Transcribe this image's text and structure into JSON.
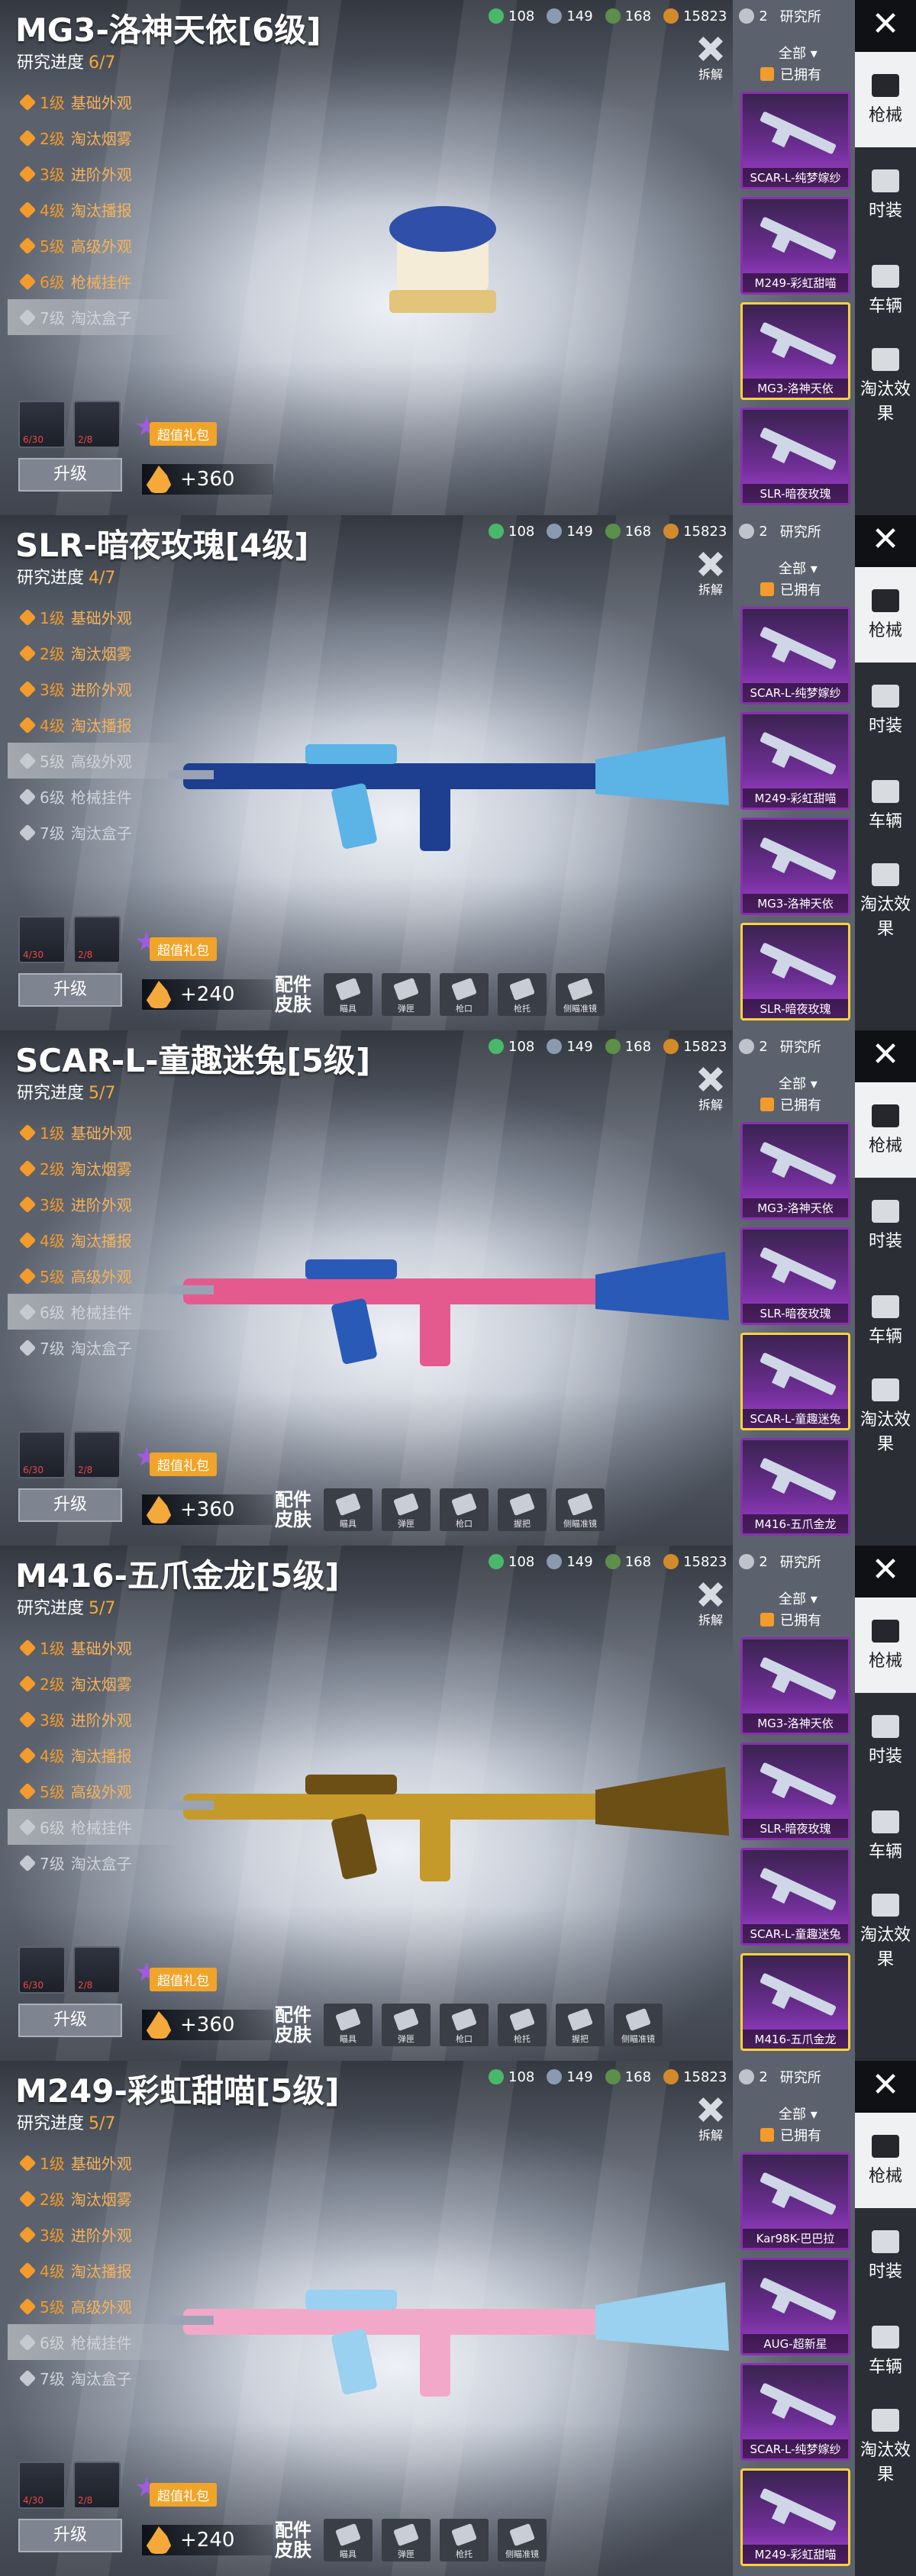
{
  "top_stats": [
    {
      "icon": "gem-icon",
      "value": "108",
      "color": "#4ab86a"
    },
    {
      "icon": "info-icon",
      "value": "149",
      "color": "#8a9ab0"
    },
    {
      "icon": "planet-icon",
      "value": "168",
      "color": "#5c8f4a"
    },
    {
      "icon": "coin-icon",
      "value": "15823",
      "color": "#d38a2a"
    },
    {
      "icon": "research-icon",
      "value": "2",
      "color": "#bfc4cc"
    }
  ],
  "research_label": "研究所",
  "toggle_label": "拆解",
  "filter": {
    "selected": "全部",
    "owned": "已拥有"
  },
  "nav": [
    "枪械",
    "时装",
    "车辆",
    "淘汰效果"
  ],
  "upgrade": "升级",
  "gift": "超值礼包",
  "parts_label": "配件皮肤",
  "progress_label": "研究进度",
  "panels": [
    {
      "title": "MG3-洛神天依[6级]",
      "progress": "6/7",
      "levels": [
        [
          "1级",
          "基础外观"
        ],
        [
          "2级",
          "淘汰烟雾"
        ],
        [
          "3级",
          "进阶外观"
        ],
        [
          "4级",
          "淘汰播报"
        ],
        [
          "5级",
          "高级外观"
        ],
        [
          "6级",
          "枪械挂件"
        ],
        [
          "7级",
          "淘汰盒子"
        ]
      ],
      "unlocked": 6,
      "points": "+360",
      "skins": [
        "SCAR-L-纯梦嫁纱",
        "M249-彩虹甜喵",
        "MG3-洛神天依",
        "SLR-暗夜玫瑰"
      ],
      "sel": 2,
      "parts": [],
      "counts": [
        "6/30",
        "2/8"
      ]
    },
    {
      "title": "SLR-暗夜玫瑰[4级]",
      "progress": "4/7",
      "levels": [
        [
          "1级",
          "基础外观"
        ],
        [
          "2级",
          "淘汰烟雾"
        ],
        [
          "3级",
          "进阶外观"
        ],
        [
          "4级",
          "淘汰播报"
        ],
        [
          "5级",
          "高级外观"
        ],
        [
          "6级",
          "枪械挂件"
        ],
        [
          "7级",
          "淘汰盒子"
        ]
      ],
      "unlocked": 4,
      "points": "+240",
      "skins": [
        "SCAR-L-纯梦嫁纱",
        "M249-彩虹甜喵",
        "MG3-洛神天依",
        "SLR-暗夜玫瑰"
      ],
      "sel": 3,
      "parts": [
        "瞄具",
        "弹匣",
        "枪口",
        "枪托",
        "侧瞄准镜"
      ],
      "counts": [
        "4/30",
        "2/8"
      ]
    },
    {
      "title": "SCAR-L-童趣迷兔[5级]",
      "progress": "5/7",
      "levels": [
        [
          "1级",
          "基础外观"
        ],
        [
          "2级",
          "淘汰烟雾"
        ],
        [
          "3级",
          "进阶外观"
        ],
        [
          "4级",
          "淘汰播报"
        ],
        [
          "5级",
          "高级外观"
        ],
        [
          "6级",
          "枪械挂件"
        ],
        [
          "7级",
          "淘汰盒子"
        ]
      ],
      "unlocked": 5,
      "points": "+360",
      "skins": [
        "MG3-洛神天依",
        "SLR-暗夜玫瑰",
        "SCAR-L-童趣迷兔",
        "M416-五爪金龙"
      ],
      "sel": 2,
      "parts": [
        "瞄具",
        "弹匣",
        "枪口",
        "握把",
        "侧瞄准镜"
      ],
      "counts": [
        "6/30",
        "2/8"
      ]
    },
    {
      "title": "M416-五爪金龙[5级]",
      "progress": "5/7",
      "levels": [
        [
          "1级",
          "基础外观"
        ],
        [
          "2级",
          "淘汰烟雾"
        ],
        [
          "3级",
          "进阶外观"
        ],
        [
          "4级",
          "淘汰播报"
        ],
        [
          "5级",
          "高级外观"
        ],
        [
          "6级",
          "枪械挂件"
        ],
        [
          "7级",
          "淘汰盒子"
        ]
      ],
      "unlocked": 5,
      "points": "+360",
      "skins": [
        "MG3-洛神天依",
        "SLR-暗夜玫瑰",
        "SCAR-L-童趣迷兔",
        "M416-五爪金龙"
      ],
      "sel": 3,
      "parts": [
        "瞄具",
        "弹匣",
        "枪口",
        "枪托",
        "握把",
        "侧瞄准镜"
      ],
      "counts": [
        "6/30",
        "2/8"
      ]
    },
    {
      "title": "M249-彩虹甜喵[5级]",
      "progress": "5/7",
      "levels": [
        [
          "1级",
          "基础外观"
        ],
        [
          "2级",
          "淘汰烟雾"
        ],
        [
          "3级",
          "进阶外观"
        ],
        [
          "4级",
          "淘汰播报"
        ],
        [
          "5级",
          "高级外观"
        ],
        [
          "6级",
          "枪械挂件"
        ],
        [
          "7级",
          "淘汰盒子"
        ]
      ],
      "unlocked": 5,
      "points": "+240",
      "skins": [
        "Kar98K-巴巴拉",
        "AUG-超新星",
        "SCAR-L-纯梦嫁纱",
        "M249-彩虹甜喵"
      ],
      "sel": 3,
      "parts": [
        "瞄具",
        "弹匣",
        "枪托",
        "侧瞄准镜"
      ],
      "counts": [
        "4/30",
        "2/8"
      ]
    }
  ]
}
